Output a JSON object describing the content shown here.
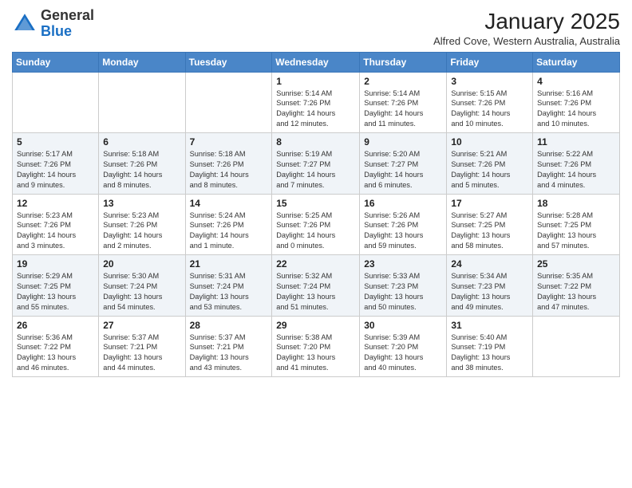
{
  "logo": {
    "general": "General",
    "blue": "Blue"
  },
  "header": {
    "month_year": "January 2025",
    "location": "Alfred Cove, Western Australia, Australia"
  },
  "weekdays": [
    "Sunday",
    "Monday",
    "Tuesday",
    "Wednesday",
    "Thursday",
    "Friday",
    "Saturday"
  ],
  "weeks": [
    [
      {
        "day": "",
        "info": ""
      },
      {
        "day": "",
        "info": ""
      },
      {
        "day": "",
        "info": ""
      },
      {
        "day": "1",
        "info": "Sunrise: 5:14 AM\nSunset: 7:26 PM\nDaylight: 14 hours\nand 12 minutes."
      },
      {
        "day": "2",
        "info": "Sunrise: 5:14 AM\nSunset: 7:26 PM\nDaylight: 14 hours\nand 11 minutes."
      },
      {
        "day": "3",
        "info": "Sunrise: 5:15 AM\nSunset: 7:26 PM\nDaylight: 14 hours\nand 10 minutes."
      },
      {
        "day": "4",
        "info": "Sunrise: 5:16 AM\nSunset: 7:26 PM\nDaylight: 14 hours\nand 10 minutes."
      }
    ],
    [
      {
        "day": "5",
        "info": "Sunrise: 5:17 AM\nSunset: 7:26 PM\nDaylight: 14 hours\nand 9 minutes."
      },
      {
        "day": "6",
        "info": "Sunrise: 5:18 AM\nSunset: 7:26 PM\nDaylight: 14 hours\nand 8 minutes."
      },
      {
        "day": "7",
        "info": "Sunrise: 5:18 AM\nSunset: 7:26 PM\nDaylight: 14 hours\nand 8 minutes."
      },
      {
        "day": "8",
        "info": "Sunrise: 5:19 AM\nSunset: 7:27 PM\nDaylight: 14 hours\nand 7 minutes."
      },
      {
        "day": "9",
        "info": "Sunrise: 5:20 AM\nSunset: 7:27 PM\nDaylight: 14 hours\nand 6 minutes."
      },
      {
        "day": "10",
        "info": "Sunrise: 5:21 AM\nSunset: 7:26 PM\nDaylight: 14 hours\nand 5 minutes."
      },
      {
        "day": "11",
        "info": "Sunrise: 5:22 AM\nSunset: 7:26 PM\nDaylight: 14 hours\nand 4 minutes."
      }
    ],
    [
      {
        "day": "12",
        "info": "Sunrise: 5:23 AM\nSunset: 7:26 PM\nDaylight: 14 hours\nand 3 minutes."
      },
      {
        "day": "13",
        "info": "Sunrise: 5:23 AM\nSunset: 7:26 PM\nDaylight: 14 hours\nand 2 minutes."
      },
      {
        "day": "14",
        "info": "Sunrise: 5:24 AM\nSunset: 7:26 PM\nDaylight: 14 hours\nand 1 minute."
      },
      {
        "day": "15",
        "info": "Sunrise: 5:25 AM\nSunset: 7:26 PM\nDaylight: 14 hours\nand 0 minutes."
      },
      {
        "day": "16",
        "info": "Sunrise: 5:26 AM\nSunset: 7:26 PM\nDaylight: 13 hours\nand 59 minutes."
      },
      {
        "day": "17",
        "info": "Sunrise: 5:27 AM\nSunset: 7:25 PM\nDaylight: 13 hours\nand 58 minutes."
      },
      {
        "day": "18",
        "info": "Sunrise: 5:28 AM\nSunset: 7:25 PM\nDaylight: 13 hours\nand 57 minutes."
      }
    ],
    [
      {
        "day": "19",
        "info": "Sunrise: 5:29 AM\nSunset: 7:25 PM\nDaylight: 13 hours\nand 55 minutes."
      },
      {
        "day": "20",
        "info": "Sunrise: 5:30 AM\nSunset: 7:24 PM\nDaylight: 13 hours\nand 54 minutes."
      },
      {
        "day": "21",
        "info": "Sunrise: 5:31 AM\nSunset: 7:24 PM\nDaylight: 13 hours\nand 53 minutes."
      },
      {
        "day": "22",
        "info": "Sunrise: 5:32 AM\nSunset: 7:24 PM\nDaylight: 13 hours\nand 51 minutes."
      },
      {
        "day": "23",
        "info": "Sunrise: 5:33 AM\nSunset: 7:23 PM\nDaylight: 13 hours\nand 50 minutes."
      },
      {
        "day": "24",
        "info": "Sunrise: 5:34 AM\nSunset: 7:23 PM\nDaylight: 13 hours\nand 49 minutes."
      },
      {
        "day": "25",
        "info": "Sunrise: 5:35 AM\nSunset: 7:22 PM\nDaylight: 13 hours\nand 47 minutes."
      }
    ],
    [
      {
        "day": "26",
        "info": "Sunrise: 5:36 AM\nSunset: 7:22 PM\nDaylight: 13 hours\nand 46 minutes."
      },
      {
        "day": "27",
        "info": "Sunrise: 5:37 AM\nSunset: 7:21 PM\nDaylight: 13 hours\nand 44 minutes."
      },
      {
        "day": "28",
        "info": "Sunrise: 5:37 AM\nSunset: 7:21 PM\nDaylight: 13 hours\nand 43 minutes."
      },
      {
        "day": "29",
        "info": "Sunrise: 5:38 AM\nSunset: 7:20 PM\nDaylight: 13 hours\nand 41 minutes."
      },
      {
        "day": "30",
        "info": "Sunrise: 5:39 AM\nSunset: 7:20 PM\nDaylight: 13 hours\nand 40 minutes."
      },
      {
        "day": "31",
        "info": "Sunrise: 5:40 AM\nSunset: 7:19 PM\nDaylight: 13 hours\nand 38 minutes."
      },
      {
        "day": "",
        "info": ""
      }
    ]
  ]
}
